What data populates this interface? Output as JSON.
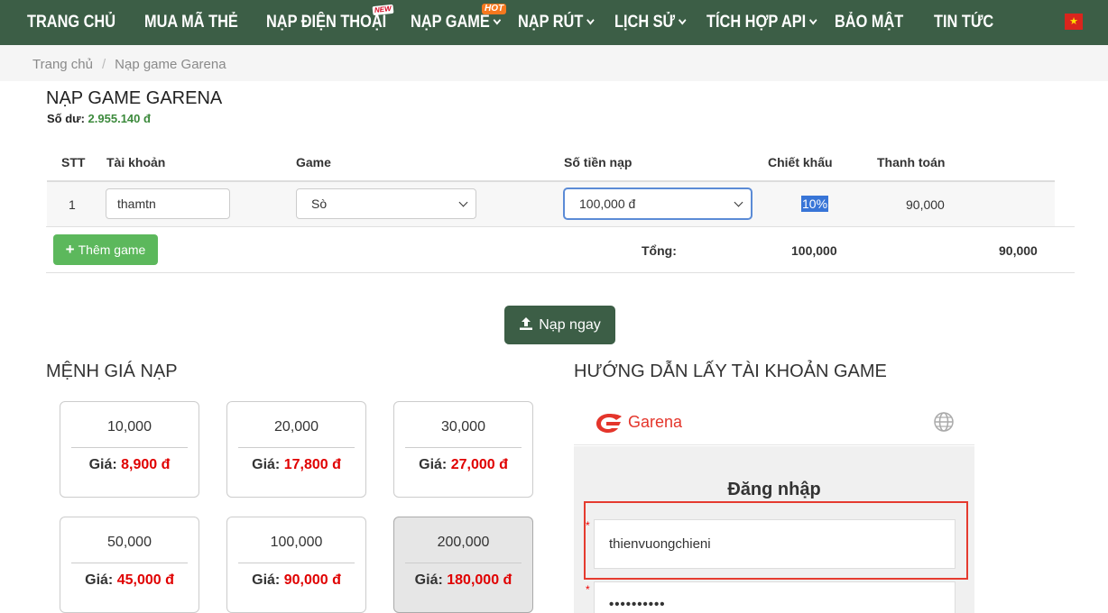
{
  "nav": {
    "items": [
      {
        "label": "TRANG CHỦ",
        "dropdown": false
      },
      {
        "label": "MUA MÃ THẺ",
        "dropdown": false
      },
      {
        "label": "NẠP ĐIỆN THOẠI",
        "dropdown": false,
        "badge": "NEW"
      },
      {
        "label": "NẠP GAME",
        "dropdown": true,
        "badge": "HOT"
      },
      {
        "label": "NẠP RÚT",
        "dropdown": true
      },
      {
        "label": "LỊCH SỬ",
        "dropdown": true
      },
      {
        "label": "TÍCH HỢP API",
        "dropdown": true
      },
      {
        "label": "BẢO MẬT",
        "dropdown": false
      },
      {
        "label": "TIN TỨC",
        "dropdown": false
      }
    ],
    "flag_star": "★"
  },
  "breadcrumb": {
    "home": "Trang chủ",
    "separator": "/",
    "current": "Nạp game Garena"
  },
  "page": {
    "title": "NẠP GAME GARENA",
    "balance_label": "Số dư:",
    "balance_value": "2.955.140 đ"
  },
  "table": {
    "headers": {
      "stt": "STT",
      "account": "Tài khoản",
      "game": "Game",
      "amount": "Số tiền nạp",
      "discount": "Chiết khấu",
      "payment": "Thanh toán"
    },
    "rows": [
      {
        "stt": "1",
        "account": "thamtn",
        "game": "Sò",
        "amount": "100,000 đ",
        "discount": "10%",
        "payment": "90,000"
      }
    ],
    "add_button": "Thêm game",
    "total_label": "Tổng:",
    "total_amount": "100,000",
    "total_payment": "90,000"
  },
  "submit_button": "Nạp ngay",
  "denominations": {
    "title": "MỆNH GIÁ NẠP",
    "price_label": "Giá:",
    "cards": [
      {
        "value": "10,000",
        "price": "8,900 đ",
        "selected": false
      },
      {
        "value": "20,000",
        "price": "17,800 đ",
        "selected": false
      },
      {
        "value": "30,000",
        "price": "27,000 đ",
        "selected": false
      },
      {
        "value": "50,000",
        "price": "45,000 đ",
        "selected": false
      },
      {
        "value": "100,000",
        "price": "90,000 đ",
        "selected": false
      },
      {
        "value": "200,000",
        "price": "180,000 đ",
        "selected": true
      }
    ]
  },
  "guide": {
    "title": "HƯỚNG DẪN LẤY TÀI KHOẢN GAME",
    "brand": "Garena",
    "login_title": "Đăng nhập",
    "username": "thienvuongchieni",
    "password": "••••••••••",
    "required_mark": "*"
  },
  "colors": {
    "nav_bg": "#3c5e46",
    "accent_green": "#5cb85c",
    "price_red": "#e00000",
    "balance_green": "#3c8a3c",
    "highlight_red": "#e53b2f"
  }
}
